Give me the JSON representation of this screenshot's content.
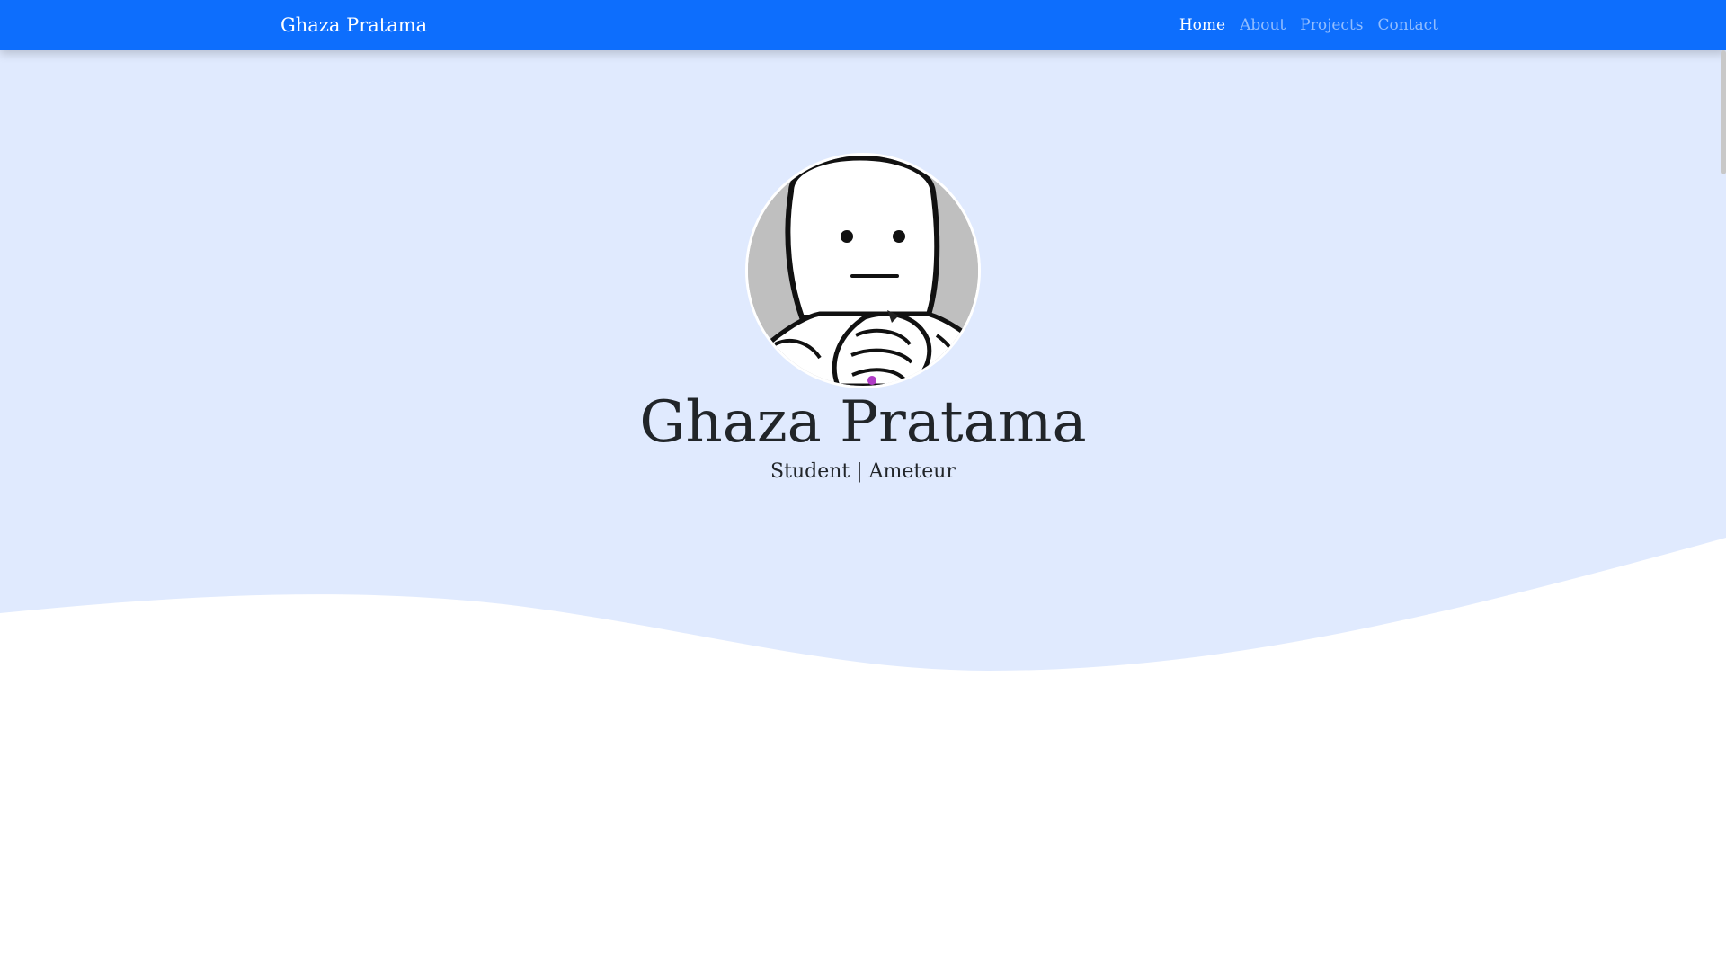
{
  "navbar": {
    "brand": "Ghaza Pratama",
    "links": [
      {
        "label": "Home",
        "active": true
      },
      {
        "label": "About",
        "active": false
      },
      {
        "label": "Projects",
        "active": false
      },
      {
        "label": "Contact",
        "active": false
      }
    ]
  },
  "hero": {
    "avatar_icon": "cartoon-face-avatar",
    "title": "Ghaza Pratama",
    "subtitle": "Student | Ameteur"
  },
  "colors": {
    "navbar_bg": "#0d6efd",
    "hero_bg": "#e0eafe",
    "text": "#212529"
  }
}
